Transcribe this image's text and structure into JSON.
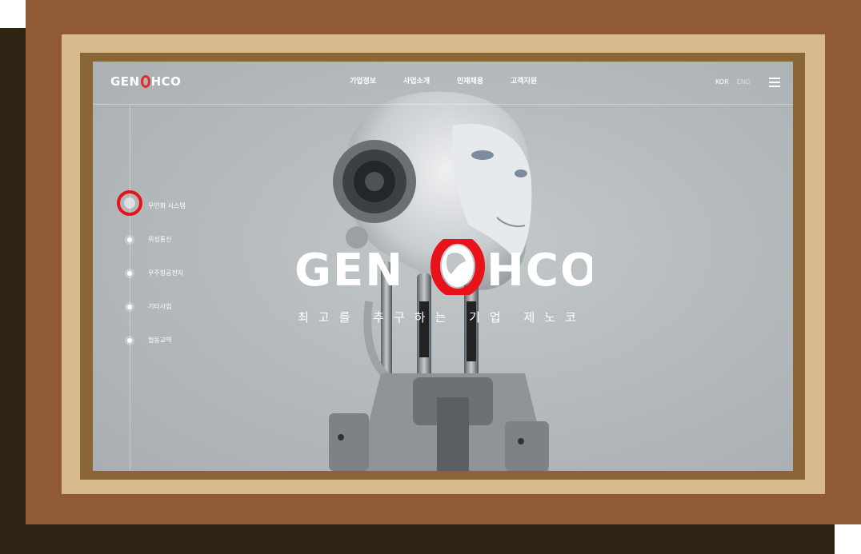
{
  "brand": {
    "logo_left": "GEN",
    "logo_right": "HCO",
    "accent_color": "#e32a2a"
  },
  "nav": {
    "items": [
      "기업정보",
      "사업소개",
      "인재채용",
      "고객지원"
    ]
  },
  "lang": {
    "kor": "KOR",
    "eng": "ENG"
  },
  "side_nav": {
    "items": [
      "무인화 시스템",
      "위성통신",
      "우주항공전자",
      "기타사업",
      "협동교역"
    ],
    "active_index": 0
  },
  "hero": {
    "logo_left": "GEN",
    "logo_right": "HCO",
    "tagline": "최고를 추구하는 기업 제노코"
  },
  "icons": [
    "hamburger-menu-icon",
    "globe-o-icon"
  ]
}
